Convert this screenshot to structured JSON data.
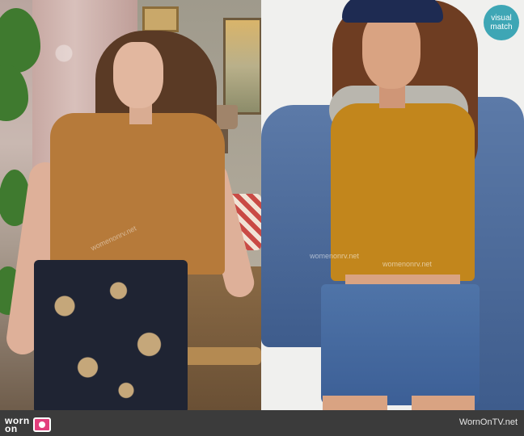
{
  "badge": {
    "line1": "visual",
    "line2": "match",
    "color": "#3ea6b5"
  },
  "watermark": {
    "text": "womenonrv.net"
  },
  "footer": {
    "logo_line1": "worn",
    "logo_line2": "on",
    "logo_icon": "tv-icon",
    "site": "WornOnTV.net",
    "background": "#3b3b3b",
    "accent": "#e23e7c"
  }
}
